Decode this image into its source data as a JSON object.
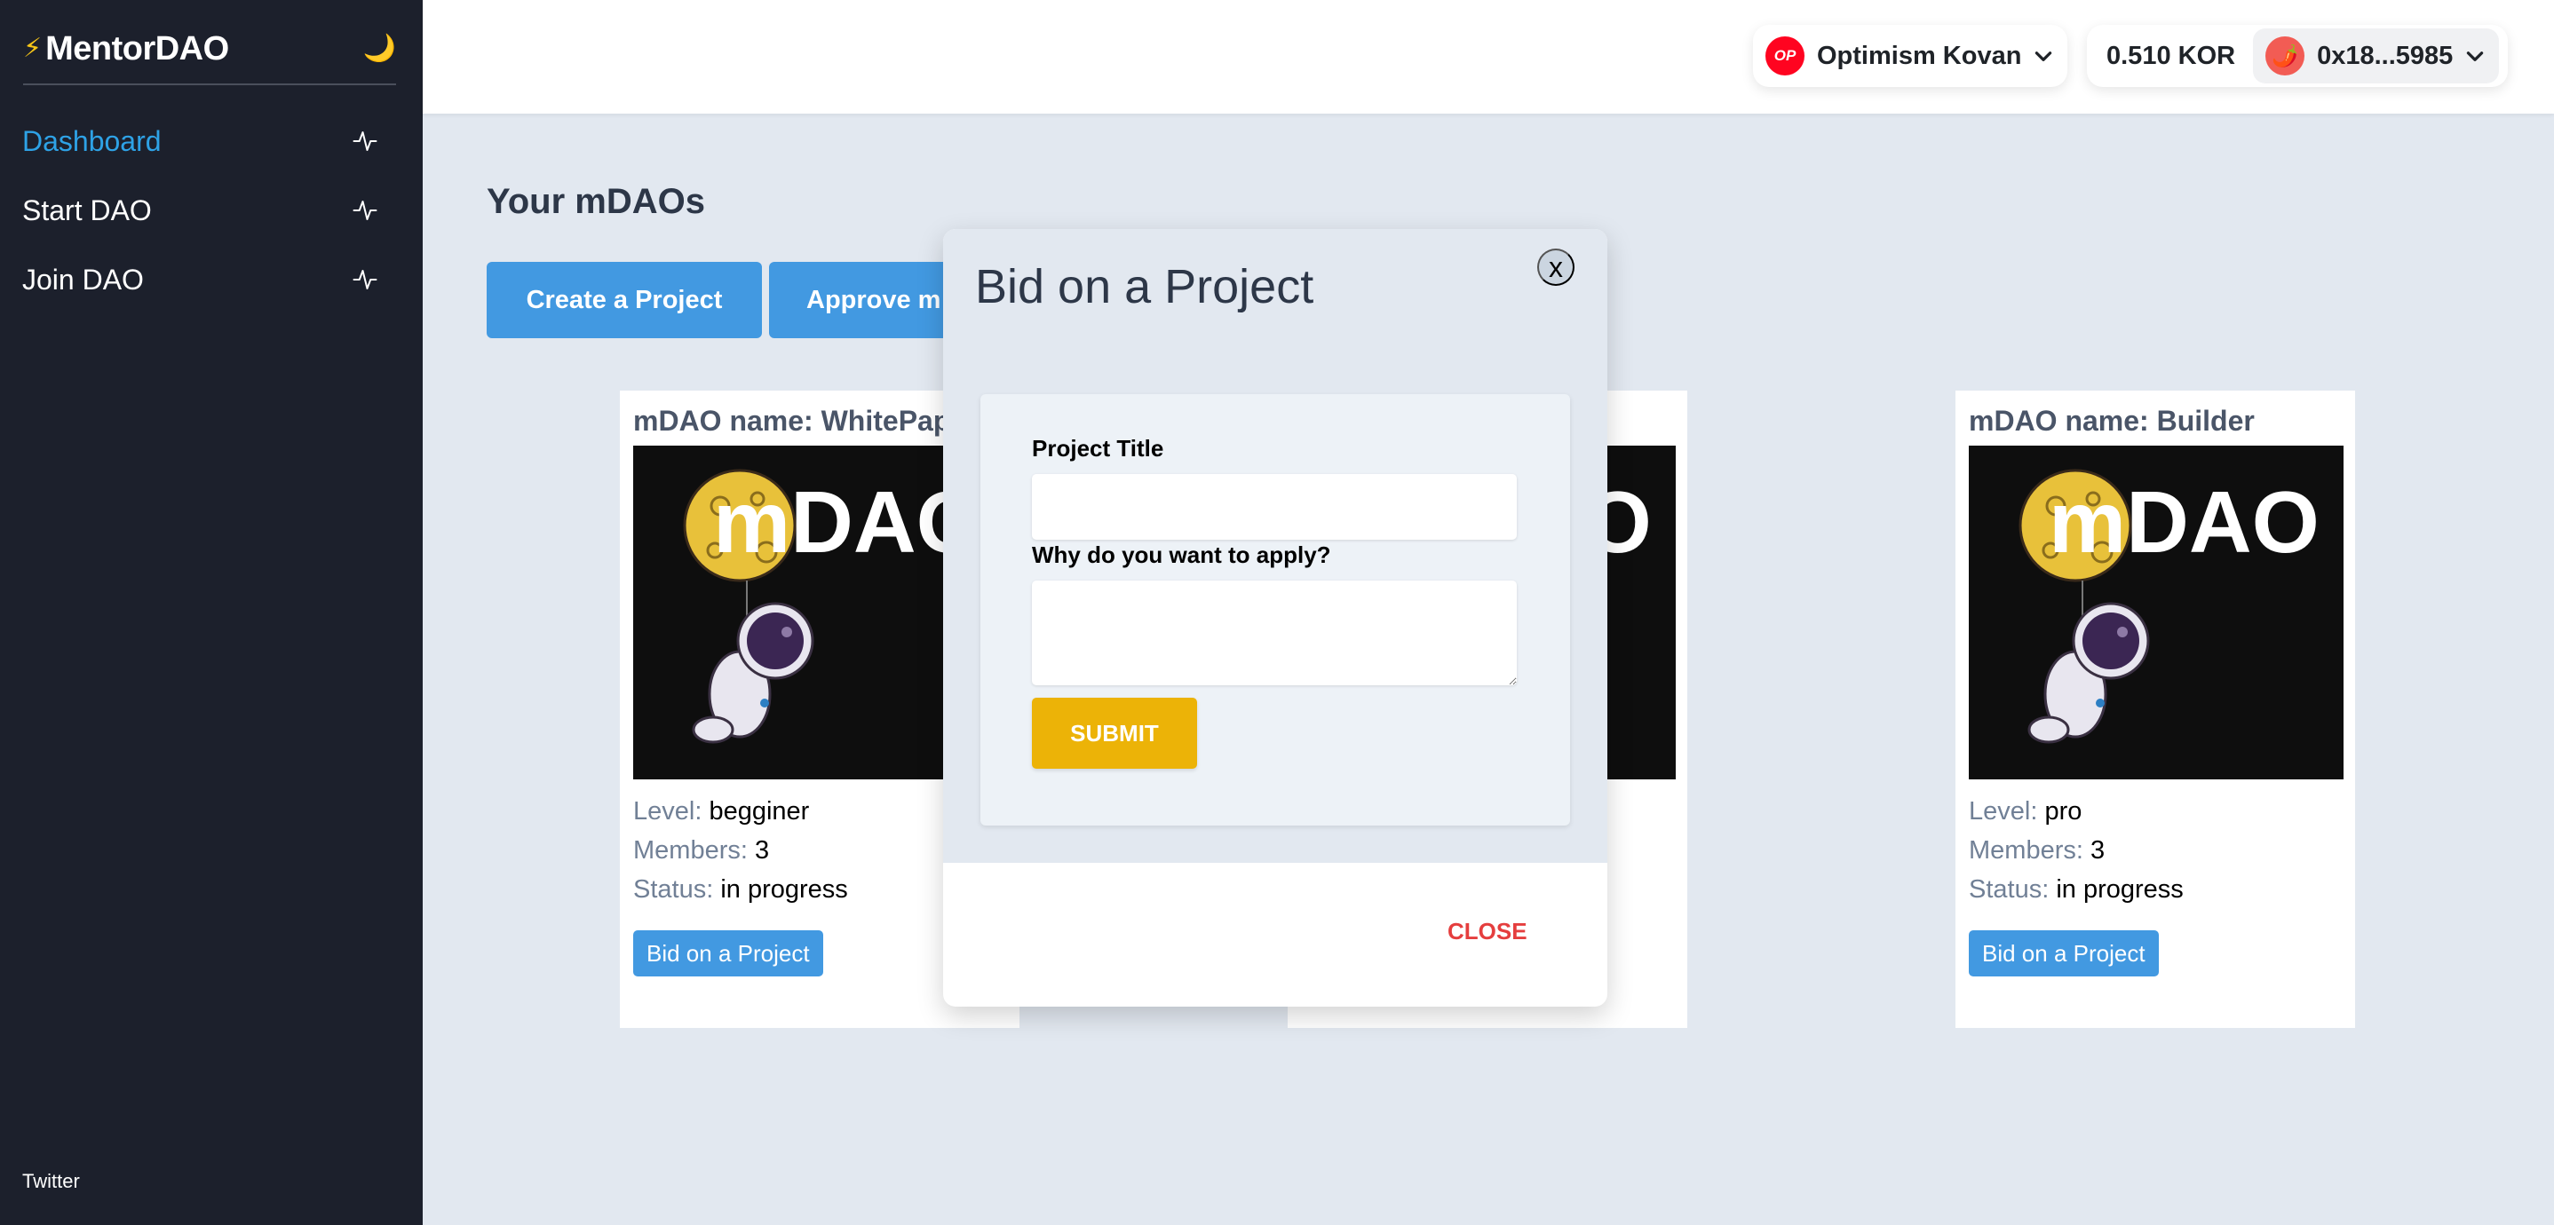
{
  "app": {
    "brand": "MentorDAO",
    "brand_icon": "lightning-bolt-icon",
    "theme_toggle_icon": "moon-icon",
    "accent_color": "#4299e1",
    "active_nav_color": "#2ea2e6"
  },
  "sidebar": {
    "items": [
      {
        "label": "Dashboard",
        "icon": "activity-pulse-icon",
        "active": true
      },
      {
        "label": "Start DAO",
        "icon": "activity-pulse-icon",
        "active": false
      },
      {
        "label": "Join DAO",
        "icon": "activity-pulse-icon",
        "active": false
      }
    ],
    "footer_link": "Twitter"
  },
  "topbar": {
    "network": {
      "logo_text": "OP",
      "name": "Optimism Kovan",
      "color": "#ff0420"
    },
    "balance": "0.510 KOR",
    "account": {
      "avatar": "🌶️",
      "address": "0x18...5985",
      "avatar_color": "#f25c54"
    }
  },
  "main": {
    "title": "Your mDAOs",
    "toolbar": {
      "create_label": "Create a Project",
      "approve_label": "Approve m"
    },
    "cards": [
      {
        "title": "mDAO name: WhitePap",
        "image_text": "mDAO",
        "level_label": "Level:",
        "level": "begginer",
        "members_label": "Members:",
        "members": "3",
        "status_label": "Status:",
        "status": "in progress",
        "button": "Bid on a Project"
      },
      {
        "title": "",
        "image_text": "mDAO",
        "level_label": "",
        "level": "",
        "members_label": "",
        "members": "",
        "status_label": "",
        "status": "",
        "button": ""
      },
      {
        "title": "mDAO name: Builder",
        "image_text": "mDAO",
        "level_label": "Level:",
        "level": "pro",
        "members_label": "Members:",
        "members": "3",
        "status_label": "Status:",
        "status": "in progress",
        "button": "Bid on a Project"
      }
    ]
  },
  "modal": {
    "title": "Bid on a Project",
    "close_x": "x",
    "fields": {
      "project_title_label": "Project Title",
      "project_title_value": "",
      "reason_label": "Why do you want to apply?",
      "reason_value": ""
    },
    "submit_label": "SUBMIT",
    "close_label": "CLOSE",
    "submit_color": "#ecb307",
    "close_color": "#e53e3e"
  }
}
